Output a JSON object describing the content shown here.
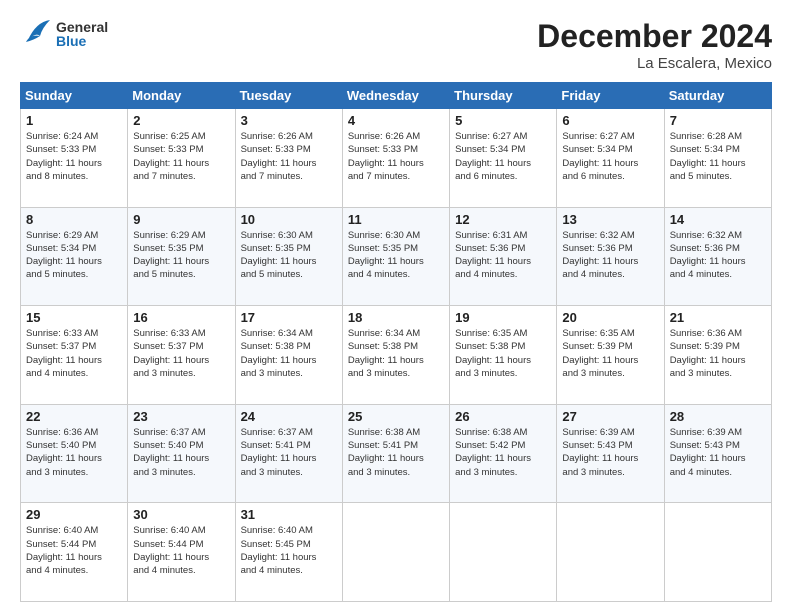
{
  "header": {
    "logo_general": "General",
    "logo_blue": "Blue",
    "month_title": "December 2024",
    "location": "La Escalera, Mexico"
  },
  "days_of_week": [
    "Sunday",
    "Monday",
    "Tuesday",
    "Wednesday",
    "Thursday",
    "Friday",
    "Saturday"
  ],
  "weeks": [
    [
      {
        "day": "1",
        "sunrise": "6:24 AM",
        "sunset": "5:33 PM",
        "daylight": "11 hours and 8 minutes."
      },
      {
        "day": "2",
        "sunrise": "6:25 AM",
        "sunset": "5:33 PM",
        "daylight": "11 hours and 7 minutes."
      },
      {
        "day": "3",
        "sunrise": "6:26 AM",
        "sunset": "5:33 PM",
        "daylight": "11 hours and 7 minutes."
      },
      {
        "day": "4",
        "sunrise": "6:26 AM",
        "sunset": "5:33 PM",
        "daylight": "11 hours and 7 minutes."
      },
      {
        "day": "5",
        "sunrise": "6:27 AM",
        "sunset": "5:34 PM",
        "daylight": "11 hours and 6 minutes."
      },
      {
        "day": "6",
        "sunrise": "6:27 AM",
        "sunset": "5:34 PM",
        "daylight": "11 hours and 6 minutes."
      },
      {
        "day": "7",
        "sunrise": "6:28 AM",
        "sunset": "5:34 PM",
        "daylight": "11 hours and 5 minutes."
      }
    ],
    [
      {
        "day": "8",
        "sunrise": "6:29 AM",
        "sunset": "5:34 PM",
        "daylight": "11 hours and 5 minutes."
      },
      {
        "day": "9",
        "sunrise": "6:29 AM",
        "sunset": "5:35 PM",
        "daylight": "11 hours and 5 minutes."
      },
      {
        "day": "10",
        "sunrise": "6:30 AM",
        "sunset": "5:35 PM",
        "daylight": "11 hours and 5 minutes."
      },
      {
        "day": "11",
        "sunrise": "6:30 AM",
        "sunset": "5:35 PM",
        "daylight": "11 hours and 4 minutes."
      },
      {
        "day": "12",
        "sunrise": "6:31 AM",
        "sunset": "5:36 PM",
        "daylight": "11 hours and 4 minutes."
      },
      {
        "day": "13",
        "sunrise": "6:32 AM",
        "sunset": "5:36 PM",
        "daylight": "11 hours and 4 minutes."
      },
      {
        "day": "14",
        "sunrise": "6:32 AM",
        "sunset": "5:36 PM",
        "daylight": "11 hours and 4 minutes."
      }
    ],
    [
      {
        "day": "15",
        "sunrise": "6:33 AM",
        "sunset": "5:37 PM",
        "daylight": "11 hours and 4 minutes."
      },
      {
        "day": "16",
        "sunrise": "6:33 AM",
        "sunset": "5:37 PM",
        "daylight": "11 hours and 3 minutes."
      },
      {
        "day": "17",
        "sunrise": "6:34 AM",
        "sunset": "5:38 PM",
        "daylight": "11 hours and 3 minutes."
      },
      {
        "day": "18",
        "sunrise": "6:34 AM",
        "sunset": "5:38 PM",
        "daylight": "11 hours and 3 minutes."
      },
      {
        "day": "19",
        "sunrise": "6:35 AM",
        "sunset": "5:38 PM",
        "daylight": "11 hours and 3 minutes."
      },
      {
        "day": "20",
        "sunrise": "6:35 AM",
        "sunset": "5:39 PM",
        "daylight": "11 hours and 3 minutes."
      },
      {
        "day": "21",
        "sunrise": "6:36 AM",
        "sunset": "5:39 PM",
        "daylight": "11 hours and 3 minutes."
      }
    ],
    [
      {
        "day": "22",
        "sunrise": "6:36 AM",
        "sunset": "5:40 PM",
        "daylight": "11 hours and 3 minutes."
      },
      {
        "day": "23",
        "sunrise": "6:37 AM",
        "sunset": "5:40 PM",
        "daylight": "11 hours and 3 minutes."
      },
      {
        "day": "24",
        "sunrise": "6:37 AM",
        "sunset": "5:41 PM",
        "daylight": "11 hours and 3 minutes."
      },
      {
        "day": "25",
        "sunrise": "6:38 AM",
        "sunset": "5:41 PM",
        "daylight": "11 hours and 3 minutes."
      },
      {
        "day": "26",
        "sunrise": "6:38 AM",
        "sunset": "5:42 PM",
        "daylight": "11 hours and 3 minutes."
      },
      {
        "day": "27",
        "sunrise": "6:39 AM",
        "sunset": "5:43 PM",
        "daylight": "11 hours and 3 minutes."
      },
      {
        "day": "28",
        "sunrise": "6:39 AM",
        "sunset": "5:43 PM",
        "daylight": "11 hours and 4 minutes."
      }
    ],
    [
      {
        "day": "29",
        "sunrise": "6:40 AM",
        "sunset": "5:44 PM",
        "daylight": "11 hours and 4 minutes."
      },
      {
        "day": "30",
        "sunrise": "6:40 AM",
        "sunset": "5:44 PM",
        "daylight": "11 hours and 4 minutes."
      },
      {
        "day": "31",
        "sunrise": "6:40 AM",
        "sunset": "5:45 PM",
        "daylight": "11 hours and 4 minutes."
      },
      null,
      null,
      null,
      null
    ]
  ]
}
